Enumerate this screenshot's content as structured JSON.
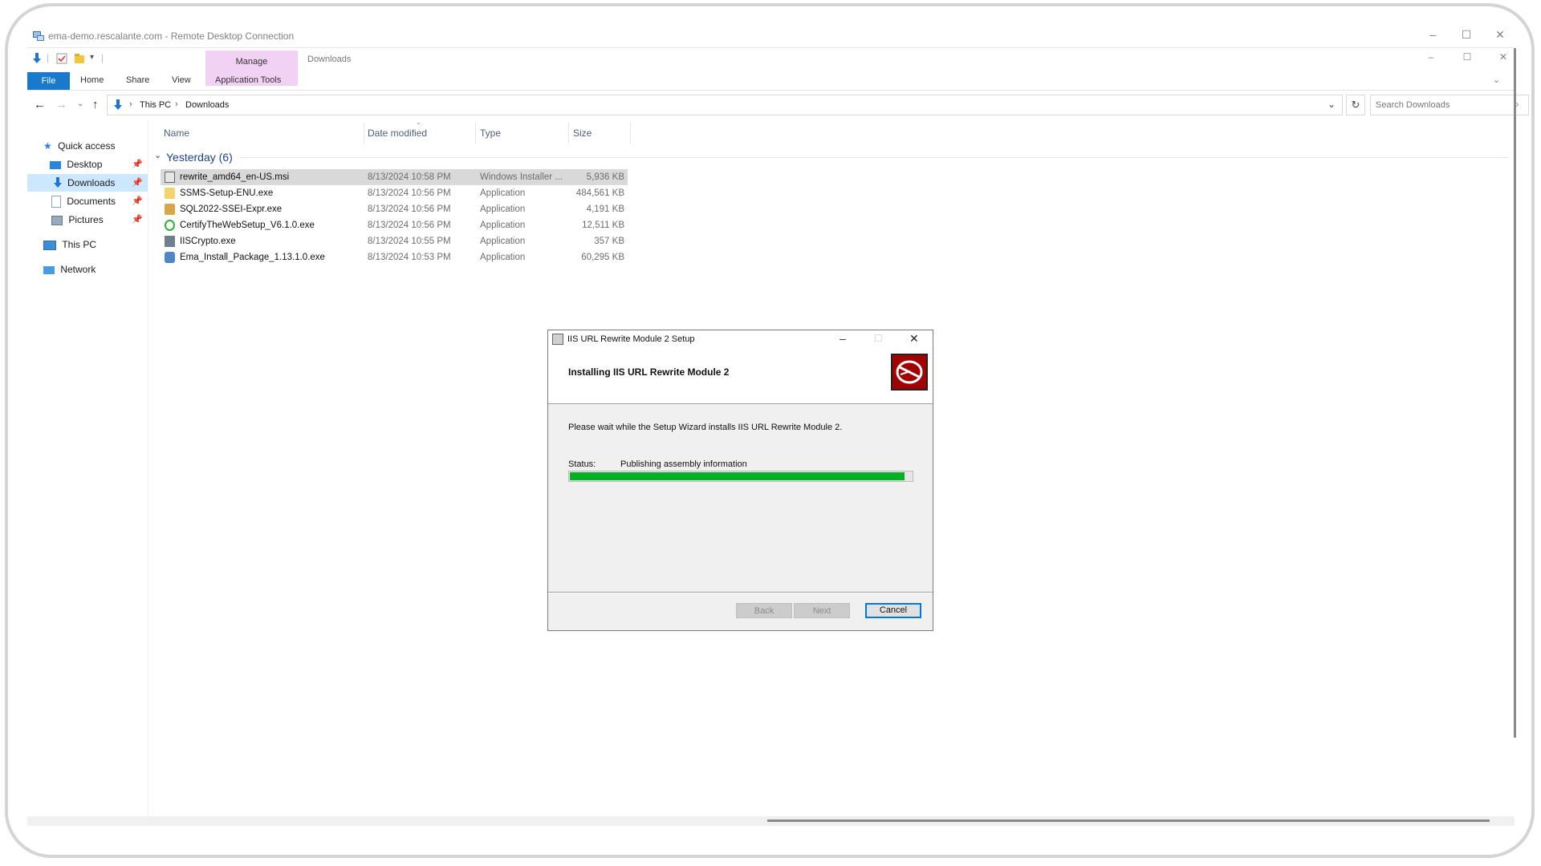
{
  "rdp": {
    "title": "ema-demo.rescalante.com - Remote Desktop Connection"
  },
  "explorer": {
    "ribbon": {
      "context_tab": "Manage",
      "window_title": "Downloads",
      "tabs": [
        "File",
        "Home",
        "Share",
        "View",
        "Application Tools"
      ]
    },
    "address": {
      "segments": [
        "This PC",
        "Downloads"
      ],
      "search_placeholder": "Search Downloads"
    },
    "nav": {
      "items": [
        {
          "label": "Quick access",
          "icon": "star-icon"
        },
        {
          "label": "Desktop",
          "icon": "desktop-icon",
          "pinned": true
        },
        {
          "label": "Downloads",
          "icon": "download-icon",
          "pinned": true,
          "selected": true
        },
        {
          "label": "Documents",
          "icon": "documents-icon",
          "pinned": true
        },
        {
          "label": "Pictures",
          "icon": "pictures-icon",
          "pinned": true
        },
        {
          "label": "This PC",
          "icon": "computer-icon"
        },
        {
          "label": "Network",
          "icon": "network-icon"
        }
      ]
    },
    "columns": [
      "Name",
      "Date modified",
      "Type",
      "Size"
    ],
    "group": "Yesterday (6)",
    "files": [
      {
        "name": "rewrite_amd64_en-US.msi",
        "date": "8/13/2024 10:58 PM",
        "type": "Windows Installer ...",
        "size": "5,936 KB",
        "icon": "msi-icon",
        "selected": true
      },
      {
        "name": "SSMS-Setup-ENU.exe",
        "date": "8/13/2024 10:56 PM",
        "type": "Application",
        "size": "484,561 KB",
        "icon": "ssms-icon"
      },
      {
        "name": "SQL2022-SSEI-Expr.exe",
        "date": "8/13/2024 10:56 PM",
        "type": "Application",
        "size": "4,191 KB",
        "icon": "sql-icon"
      },
      {
        "name": "CertifyTheWebSetup_V6.1.0.exe",
        "date": "8/13/2024 10:56 PM",
        "type": "Application",
        "size": "12,511 KB",
        "icon": "certify-icon"
      },
      {
        "name": "IISCrypto.exe",
        "date": "8/13/2024 10:55 PM",
        "type": "Application",
        "size": "357 KB",
        "icon": "iiscrypto-icon"
      },
      {
        "name": "Ema_Install_Package_1.13.1.0.exe",
        "date": "8/13/2024 10:53 PM",
        "type": "Application",
        "size": "60,295 KB",
        "icon": "ema-icon"
      }
    ]
  },
  "dialog": {
    "title": "IIS URL Rewrite Module 2 Setup",
    "heading": "Installing IIS URL Rewrite Module 2",
    "message": "Please wait while the Setup Wizard installs IIS URL Rewrite Module 2.",
    "status_label": "Status:",
    "status_text": "Publishing assembly information",
    "progress": 0.98,
    "buttons": {
      "back": "Back",
      "next": "Next",
      "cancel": "Cancel"
    },
    "colors": {
      "progress": "#06b025",
      "logo_bg": "#a30000"
    }
  }
}
